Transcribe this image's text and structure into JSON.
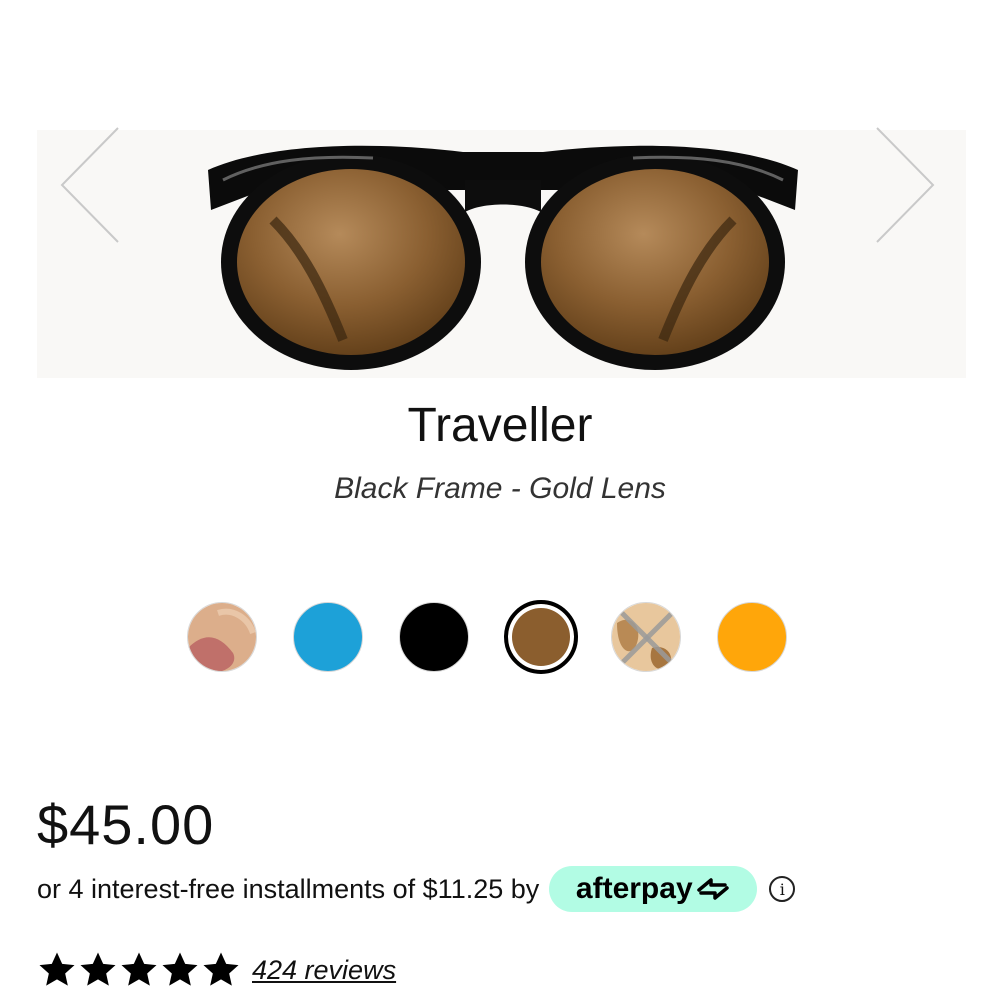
{
  "product": {
    "name": "Traveller",
    "variant": "Black Frame - Gold Lens"
  },
  "gallery": {
    "prev_icon": "chevron-left-icon",
    "next_icon": "chevron-right-icon",
    "image": "black-round-sunglasses-gold-lens"
  },
  "swatches": [
    {
      "name": "rose-tortoise",
      "color": "#d9a07e",
      "selected": false,
      "available": true
    },
    {
      "name": "blue",
      "color": "#1da1d8",
      "selected": false,
      "available": true
    },
    {
      "name": "black",
      "color": "#000000",
      "selected": false,
      "available": true
    },
    {
      "name": "brown",
      "color": "#8b5e2e",
      "selected": true,
      "available": true
    },
    {
      "name": "tortoise",
      "color": "#d6a461",
      "selected": false,
      "available": false
    },
    {
      "name": "orange",
      "color": "#ffa60a",
      "selected": false,
      "available": true
    }
  ],
  "price": "$45.00",
  "payment": {
    "installments_text": "or 4 interest-free installments of $11.25 by",
    "provider": "afterpay",
    "badge_color": "#b2fce4",
    "info_icon": "info-icon",
    "info_glyph": "i"
  },
  "rating": {
    "stars": 5,
    "reviews_label": "424 reviews"
  }
}
